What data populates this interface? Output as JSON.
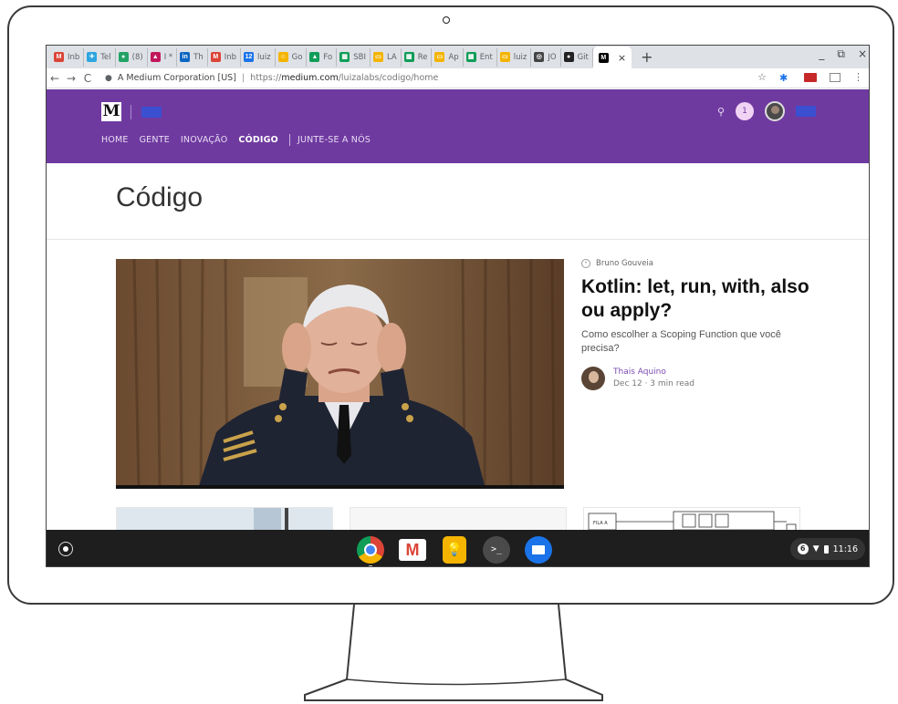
{
  "browser": {
    "tabs": [
      {
        "label": "Inb",
        "favicon_color": "#db4437",
        "favicon_glyph": "M"
      },
      {
        "label": "Tel",
        "favicon_color": "#2ca5e0",
        "favicon_glyph": "✈"
      },
      {
        "label": "(8)",
        "favicon_color": "#21a366",
        "favicon_glyph": "●"
      },
      {
        "label": "I * ",
        "favicon_color": "#c2185b",
        "favicon_glyph": "▲"
      },
      {
        "label": "Th",
        "favicon_color": "#0a66c2",
        "favicon_glyph": "in"
      },
      {
        "label": "Inb",
        "favicon_color": "#db4437",
        "favicon_glyph": "M"
      },
      {
        "label": "luiz",
        "favicon_color": "#1a73e8",
        "favicon_glyph": "12"
      },
      {
        "label": "Go",
        "favicon_color": "#f4b400",
        "favicon_glyph": "☺"
      },
      {
        "label": "Fo",
        "favicon_color": "#0f9d58",
        "favicon_glyph": "▲"
      },
      {
        "label": "SBI",
        "favicon_color": "#0f9d58",
        "favicon_glyph": "▦"
      },
      {
        "label": "LA",
        "favicon_color": "#f4b400",
        "favicon_glyph": "▭"
      },
      {
        "label": "Re",
        "favicon_color": "#0f9d58",
        "favicon_glyph": "▦"
      },
      {
        "label": "Ap",
        "favicon_color": "#f4b400",
        "favicon_glyph": "▭"
      },
      {
        "label": "Ent",
        "favicon_color": "#0f9d58",
        "favicon_glyph": "▦"
      },
      {
        "label": "luiz",
        "favicon_color": "#f4b400",
        "favicon_glyph": "▭"
      },
      {
        "label": "JO",
        "favicon_color": "#444444",
        "favicon_glyph": "◎"
      },
      {
        "label": "Git",
        "favicon_color": "#222222",
        "favicon_glyph": "●"
      }
    ],
    "active_tab": {
      "favicon_glyph": "M",
      "close_glyph": "×"
    },
    "new_tab_glyph": "+",
    "window_controls": [
      "_",
      "⧉",
      "×"
    ],
    "nav": {
      "back": "←",
      "forward": "→",
      "reload": "C"
    },
    "lock_glyph": "🔒",
    "site_identity": "A Medium Corporation [US]",
    "url_prefix": "https://",
    "url_domain": "medium.com",
    "url_path": "/luizalabs/codigo/home",
    "star_glyph": "☆",
    "menu_glyph": "⋮"
  },
  "medium": {
    "logo_letter": "M",
    "nav_items": [
      "HOME",
      "GENTE",
      "INOVAÇÃO"
    ],
    "nav_current": "CÓDIGO",
    "nav_join": "JUNTE-SE A NÓS",
    "notification_count": "1",
    "search_glyph": "⚲",
    "accent_color": "#6f3aa0"
  },
  "page": {
    "title": "Código"
  },
  "article": {
    "publication": "Bruno Gouveia",
    "title": "Kotlin: let, run, with, also ou apply?",
    "subtitle": "Como escolher a Scoping Function que você precisa?",
    "author": "Thais Aquino",
    "meta": "Dec 12 · 3 min read"
  },
  "cards": {
    "card3_label": "FILA A"
  },
  "shelf": {
    "apps": [
      "chrome",
      "gmail",
      "keep",
      "terminal",
      "files"
    ],
    "gmail_glyph": "M",
    "keep_glyph": "💡",
    "terminal_glyph": ">_",
    "status_badge": "6",
    "time": "11:16"
  }
}
